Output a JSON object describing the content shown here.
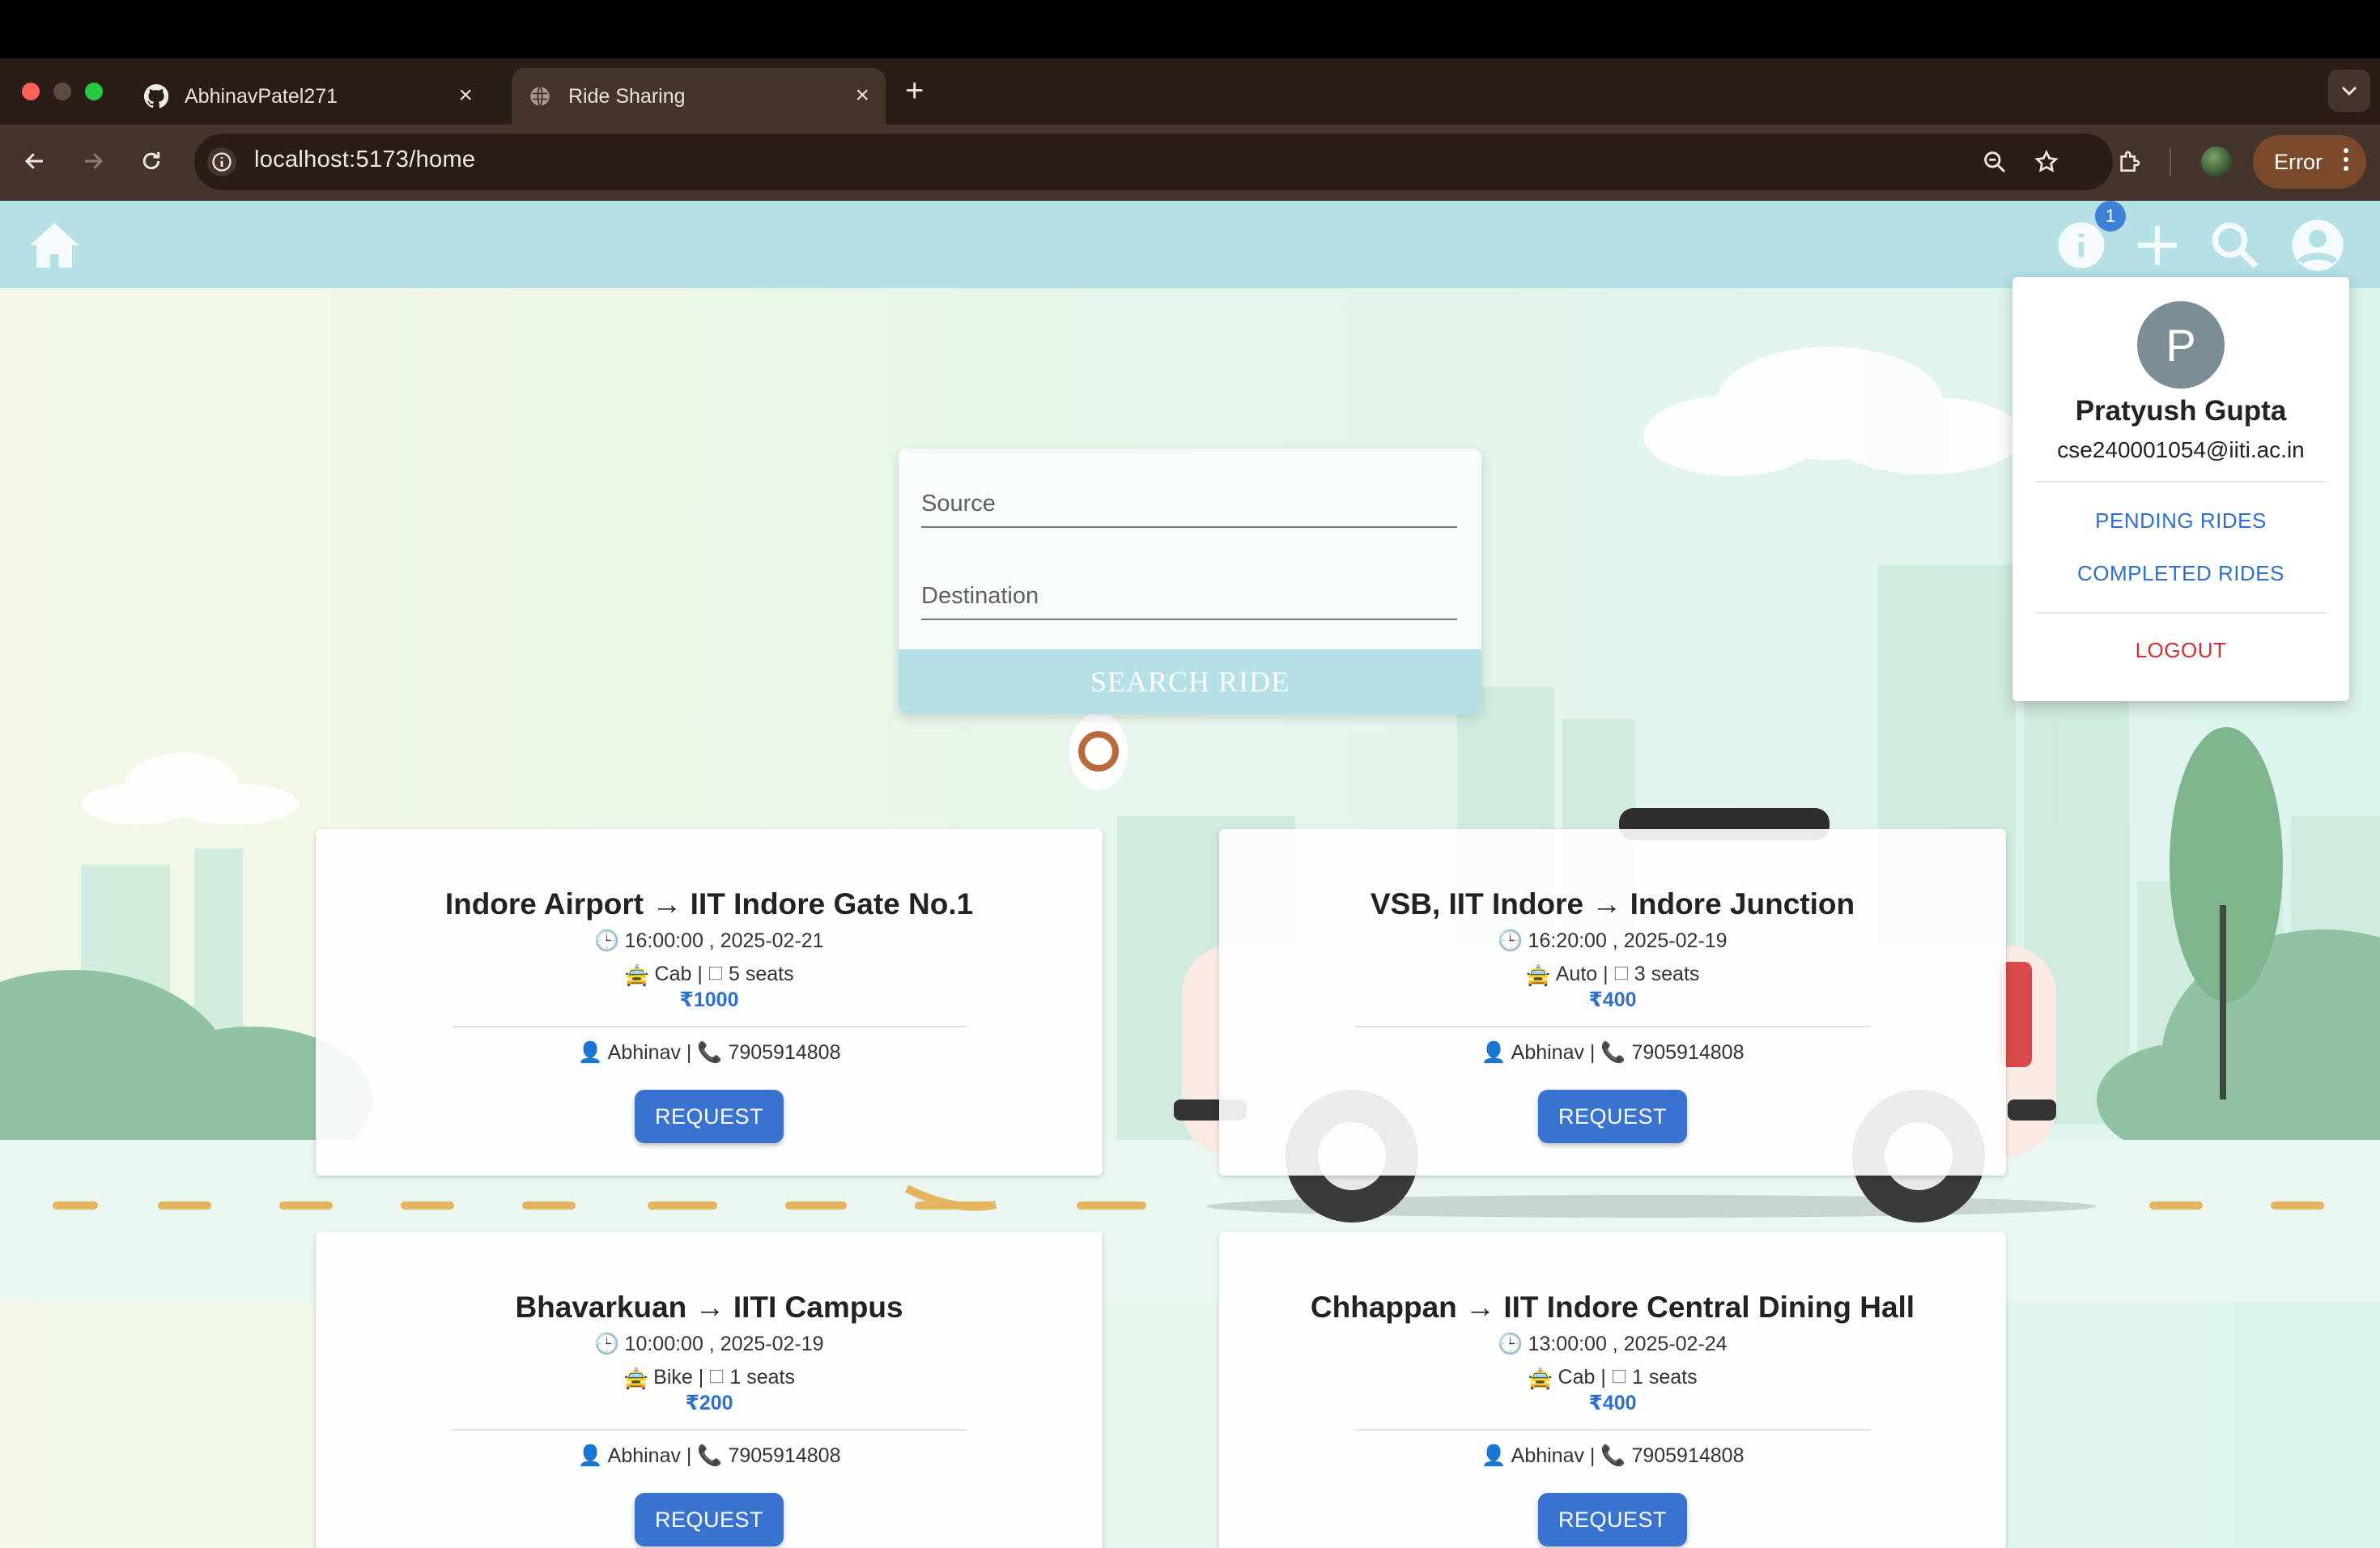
{
  "browser": {
    "tabs": [
      {
        "title": "AbhinavPatel271",
        "icon": "github-icon"
      },
      {
        "title": "Ride Sharing",
        "icon": "globe-icon"
      }
    ],
    "url": "localhost:5173/home",
    "error_label": "Error"
  },
  "app": {
    "notification_count": "1",
    "search": {
      "source_placeholder": "Source",
      "destination_placeholder": "Destination",
      "button_label": "SEARCH RIDE"
    },
    "rides": [
      {
        "title": "Indore Airport → IIT Indore Gate No.1",
        "time": "16:00:00 , 2025-02-21",
        "vehicle": "Cab | 🗆 5 seats",
        "price": "₹1000",
        "driver": "Abhinav | 📞 7905914808",
        "button": "REQUEST"
      },
      {
        "title": "VSB, IIT Indore → Indore Junction",
        "time": "16:20:00 , 2025-02-19",
        "vehicle": "Auto | 🗆 3 seats",
        "price": "₹400",
        "driver": "Abhinav | 📞 7905914808",
        "button": "REQUEST"
      },
      {
        "title": "Bhavarkuan → IITI Campus",
        "time": "10:00:00 , 2025-02-19",
        "vehicle": "Bike | 🗆 1 seats",
        "price": "₹200",
        "driver": "Abhinav | 📞 7905914808",
        "button": "REQUEST"
      },
      {
        "title": "Chhappan → IIT Indore Central Dining Hall",
        "time": "13:00:00 , 2025-02-24",
        "vehicle": "Cab | 🗆 1 seats",
        "price": "₹400",
        "driver": "Abhinav | 📞 7905914808",
        "button": "REQUEST"
      }
    ],
    "profile": {
      "initial": "P",
      "name": "Pratyush Gupta",
      "email": "cse240001054@iiti.ac.in",
      "pending_label": "PENDING RIDES",
      "completed_label": "COMPLETED RIDES",
      "logout_label": "LOGOUT"
    }
  },
  "colors": {
    "appbar": "#b4e0e6",
    "request_button": "#3a73cf",
    "price": "#2f6fcf",
    "menu_link": "#2d6ed2",
    "logout": "#d03030"
  }
}
